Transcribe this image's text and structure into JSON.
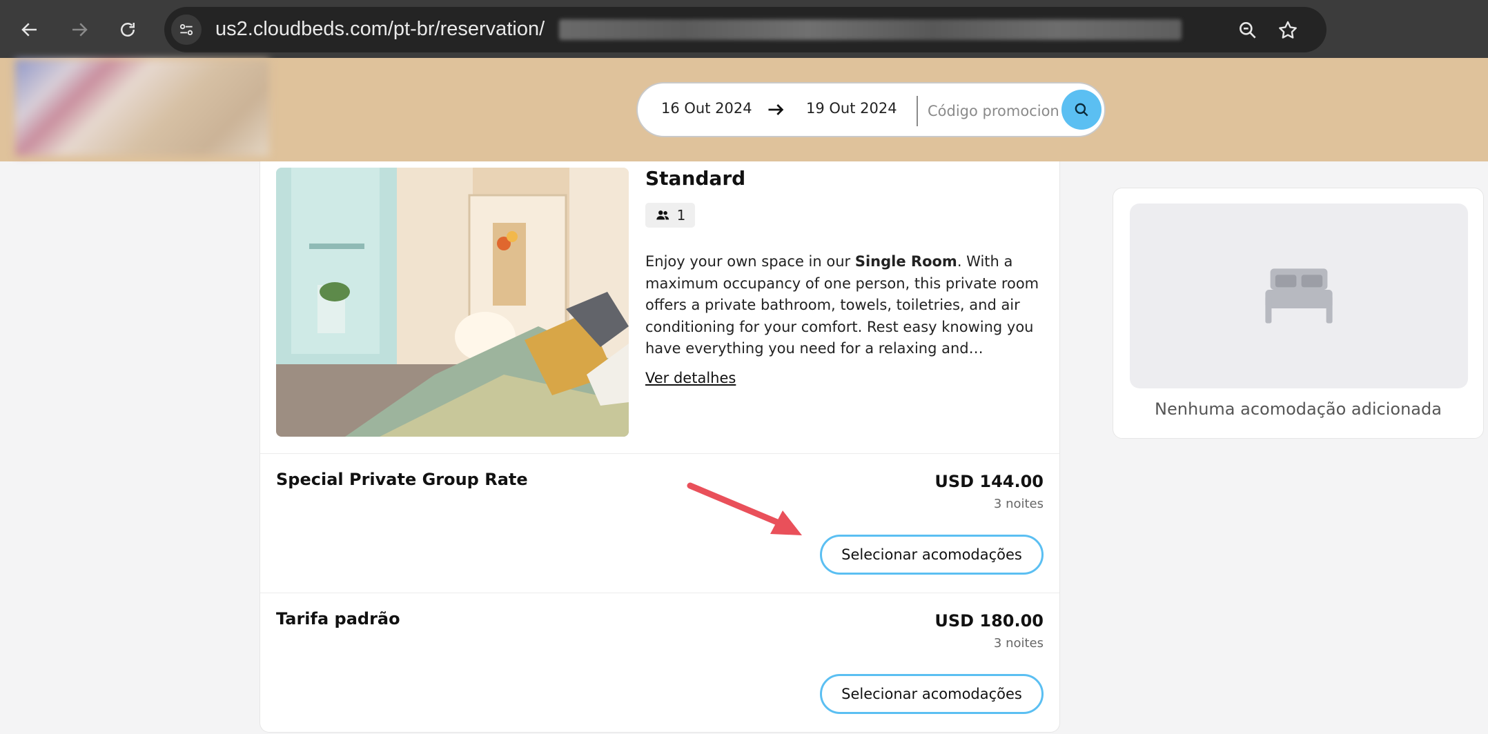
{
  "browser": {
    "url_text": "us2.cloudbeds.com/pt-br/reservation/"
  },
  "search": {
    "checkin": "16 Out 2024",
    "checkout": "19 Out 2024",
    "promo_placeholder": "Código promocional"
  },
  "room": {
    "title": "Standard",
    "occupancy": "1",
    "desc_before": "Enjoy your own space in our ",
    "desc_bold": "Single Room",
    "desc_after": ". With a maximum occupancy of one person, this private room offers a private bathroom, towels, toiletries, and air conditioning for your comfort. Rest easy knowing you have everything you need for a relaxing and…",
    "details_link": "Ver detalhes"
  },
  "rates": [
    {
      "name": "Special Private Group Rate",
      "price": "USD 144.00",
      "nights": "3 noites",
      "button": "Selecionar acomodações"
    },
    {
      "name": "Tarifa padrão",
      "price": "USD 180.00",
      "nights": "3 noites",
      "button": "Selecionar acomodações"
    }
  ],
  "summary": {
    "empty_text": "Nenhuma acomodação adicionada"
  },
  "colors": {
    "header_bg": "#dfc29b",
    "accent": "#5bbff2",
    "annotation_arrow": "#e9505a"
  }
}
